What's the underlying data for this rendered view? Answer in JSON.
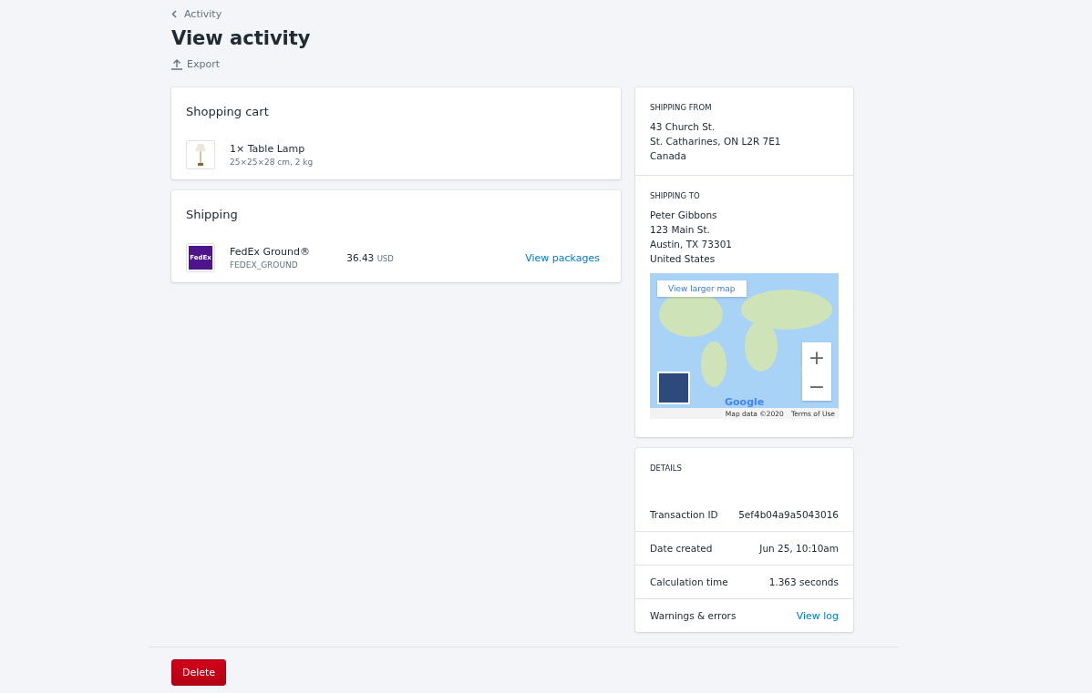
{
  "breadcrumb": {
    "label": "Activity"
  },
  "title": "View activity",
  "export": {
    "label": "Export"
  },
  "cart": {
    "title": "Shopping cart",
    "items": [
      {
        "name": "1× Table Lamp",
        "meta": "25×25×28 cm, 2 kg"
      }
    ]
  },
  "shipping": {
    "title": "Shipping",
    "rates": [
      {
        "logo": "FedEx",
        "name": "FedEx Ground®",
        "code": "FEDEX_GROUND",
        "price": "36.43",
        "currency": "USD",
        "link": "View packages"
      }
    ]
  },
  "from": {
    "heading": "SHIPPING FROM",
    "lines": [
      "43 Church St.",
      "St. Catharines, ON L2R 7E1",
      "Canada"
    ]
  },
  "to": {
    "heading": "SHIPPING TO",
    "lines": [
      "Peter Gibbons",
      "123 Main St.",
      "Austin, TX 73301",
      "United States"
    ]
  },
  "map": {
    "larger": "View larger map",
    "zoom_in": "+",
    "zoom_out": "−",
    "logo": "Google",
    "data": "Map data ©2020",
    "terms": "Terms of Use"
  },
  "details": {
    "heading": "DETAILS",
    "rows": [
      {
        "kind": "text",
        "label": "Transaction ID",
        "value": "5ef4b04a9a5043016"
      },
      {
        "kind": "text",
        "label": "Date created",
        "value": "Jun 25, 10:10am"
      },
      {
        "kind": "text",
        "label": "Calculation time",
        "value": "1.363 seconds"
      },
      {
        "kind": "link",
        "label": "Warnings & errors",
        "value": "View log"
      }
    ]
  },
  "delete": "Delete"
}
